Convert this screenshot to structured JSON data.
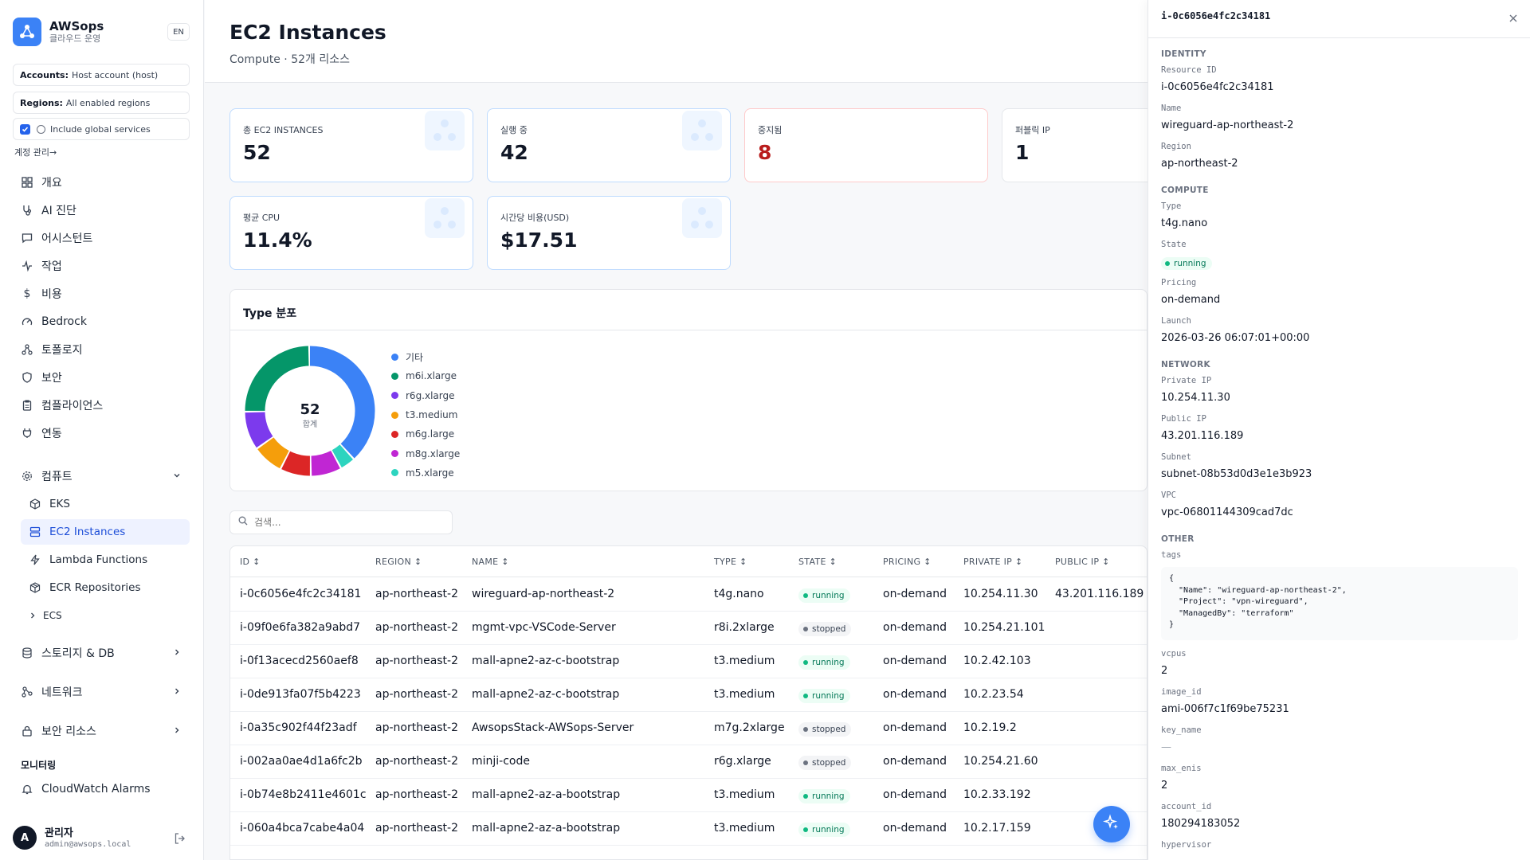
{
  "brand": {
    "name": "AWSops",
    "subtitle": "클라우드 운영",
    "lang": "EN"
  },
  "filters": {
    "accounts_label": "Accounts:",
    "accounts_value": "Host account (host)",
    "regions_label": "Regions:",
    "regions_value": "All enabled regions",
    "global_label": "Include global services",
    "account_link": "계정 관리→"
  },
  "nav": {
    "overview": "개요",
    "ai": "AI 진단",
    "assistant": "어시스턴트",
    "tasks": "작업",
    "cost": "비용",
    "bedrock": "Bedrock",
    "topology": "토폴로지",
    "security": "보안",
    "compliance": "컴플라이언스",
    "integration": "연동",
    "compute": "컴퓨트",
    "eks": "EKS",
    "ec2": "EC2 Instances",
    "lambda": "Lambda Functions",
    "ecr": "ECR Repositories",
    "ecs": "ECS",
    "storage": "스토리지 & DB",
    "network": "네트워크",
    "security_resources": "보안 리소스",
    "monitoring": "모니터링",
    "cloudwatch": "CloudWatch Alarms"
  },
  "user": {
    "initial": "A",
    "name": "관리자",
    "email": "admin@awsops.local"
  },
  "header": {
    "title": "EC2 Instances",
    "subtitle": "Compute · 52개 리소스"
  },
  "stats": [
    {
      "label": "총 EC2 INSTANCES",
      "value": "52"
    },
    {
      "label": "실행 중",
      "value": "42"
    },
    {
      "label": "중지됨",
      "value": "8"
    },
    {
      "label": "퍼블릭 IP",
      "value": "1"
    },
    {
      "label": "평균 CPU",
      "value": "11.4%"
    },
    {
      "label": "시간당 비용(USD)",
      "value": "$17.51"
    }
  ],
  "distribution": {
    "title": "Type 분포",
    "total": "52",
    "total_label": "합계",
    "segments": [
      {
        "name": "기타",
        "value": 20,
        "color": "#3b82f6"
      },
      {
        "name": "m6i.xlarge",
        "value": 2,
        "color": "#2dd4bf"
      },
      {
        "name": "r6g.xlarge",
        "value": 4,
        "color": "#c026d3"
      },
      {
        "name": "t3.medium",
        "value": 4,
        "color": "#dc2626"
      },
      {
        "name": "m6g.large",
        "value": 4,
        "color": "#f59e0b"
      },
      {
        "name": "m8g.xlarge",
        "value": 5,
        "color": "#7c3aed"
      },
      {
        "name": "m5.xlarge",
        "value": 13,
        "color": "#059669"
      }
    ],
    "legend": [
      {
        "name": "기타",
        "color": "#3b82f6"
      },
      {
        "name": "m6i.xlarge",
        "color": "#059669"
      },
      {
        "name": "r6g.xlarge",
        "color": "#7c3aed"
      },
      {
        "name": "t3.medium",
        "color": "#f59e0b"
      },
      {
        "name": "m6g.large",
        "color": "#dc2626"
      },
      {
        "name": "m8g.xlarge",
        "color": "#c026d3"
      },
      {
        "name": "m5.xlarge",
        "color": "#2dd4bf"
      }
    ]
  },
  "search": {
    "placeholder": "검색..."
  },
  "table": {
    "headers": [
      "ID ↕",
      "REGION ↕",
      "NAME ↕",
      "TYPE ↕",
      "STATE ↕",
      "PRICING ↕",
      "PRIVATE IP ↕",
      "PUBLIC IP ↕"
    ],
    "rows": [
      {
        "id": "i-0c6056e4fc2c34181",
        "region": "ap-northeast-2",
        "name": "wireguard-ap-northeast-2",
        "type": "t4g.nano",
        "state": "running",
        "pricing": "on-demand",
        "private_ip": "10.254.11.30",
        "public_ip": "43.201.116.189"
      },
      {
        "id": "i-09f0e6fa382a9abd7",
        "region": "ap-northeast-2",
        "name": "mgmt-vpc-VSCode-Server",
        "type": "r8i.2xlarge",
        "state": "stopped",
        "pricing": "on-demand",
        "private_ip": "10.254.21.101",
        "public_ip": ""
      },
      {
        "id": "i-0f13acecd2560aef8",
        "region": "ap-northeast-2",
        "name": "mall-apne2-az-c-bootstrap",
        "type": "t3.medium",
        "state": "running",
        "pricing": "on-demand",
        "private_ip": "10.2.42.103",
        "public_ip": ""
      },
      {
        "id": "i-0de913fa07f5b4223",
        "region": "ap-northeast-2",
        "name": "mall-apne2-az-c-bootstrap",
        "type": "t3.medium",
        "state": "running",
        "pricing": "on-demand",
        "private_ip": "10.2.23.54",
        "public_ip": ""
      },
      {
        "id": "i-0a35c902f44f23adf",
        "region": "ap-northeast-2",
        "name": "AwsopsStack-AWSops-Server",
        "type": "m7g.2xlarge",
        "state": "stopped",
        "pricing": "on-demand",
        "private_ip": "10.2.19.2",
        "public_ip": ""
      },
      {
        "id": "i-002aa0ae4d1a6fc2b",
        "region": "ap-northeast-2",
        "name": "minji-code",
        "type": "r6g.xlarge",
        "state": "stopped",
        "pricing": "on-demand",
        "private_ip": "10.254.21.60",
        "public_ip": ""
      },
      {
        "id": "i-0b74e8b2411e4601c",
        "region": "ap-northeast-2",
        "name": "mall-apne2-az-a-bootstrap",
        "type": "t3.medium",
        "state": "running",
        "pricing": "on-demand",
        "private_ip": "10.2.33.192",
        "public_ip": ""
      },
      {
        "id": "i-060a4bca7cabe4a04",
        "region": "ap-northeast-2",
        "name": "mall-apne2-az-a-bootstrap",
        "type": "t3.medium",
        "state": "running",
        "pricing": "on-demand",
        "private_ip": "10.2.17.159",
        "public_ip": ""
      }
    ]
  },
  "panel": {
    "title": "i-0c6056e4fc2c34181",
    "sec_identity": "IDENTITY",
    "sec_compute": "COMPUTE",
    "sec_network": "NETWORK",
    "sec_other": "OTHER",
    "k_resource_id": "Resource ID",
    "v_resource_id": "i-0c6056e4fc2c34181",
    "k_name": "Name",
    "v_name": "wireguard-ap-northeast-2",
    "k_region": "Region",
    "v_region": "ap-northeast-2",
    "k_type": "Type",
    "v_type": "t4g.nano",
    "k_state": "State",
    "v_state": "running",
    "k_pricing": "Pricing",
    "v_pricing": "on-demand",
    "k_launch": "Launch",
    "v_launch": "2026-03-26 06:07:01+00:00",
    "k_private_ip": "Private IP",
    "v_private_ip": "10.254.11.30",
    "k_public_ip": "Public IP",
    "v_public_ip": "43.201.116.189",
    "k_subnet": "Subnet",
    "v_subnet": "subnet-08b53d0d3e1e3b923",
    "k_vpc": "VPC",
    "v_vpc": "vpc-06801144309cad7dc",
    "k_tags": "tags",
    "v_tags": "{\n  \"Name\": \"wireguard-ap-northeast-2\",\n  \"Project\": \"vpn-wireguard\",\n  \"ManagedBy\": \"terraform\"\n}",
    "k_vcpus": "vcpus",
    "v_vcpus": "2",
    "k_image_id": "image_id",
    "v_image_id": "ami-006f7c1f69be75231",
    "k_key_name": "key_name",
    "v_key_name": "—",
    "k_max_enis": "max_enis",
    "v_max_enis": "2",
    "k_account_id": "account_id",
    "v_account_id": "180294183052",
    "k_hypervisor": "hypervisor"
  },
  "colors": {
    "accent": "#2563eb",
    "danger": "#b91c1c",
    "success": "#10b981"
  }
}
